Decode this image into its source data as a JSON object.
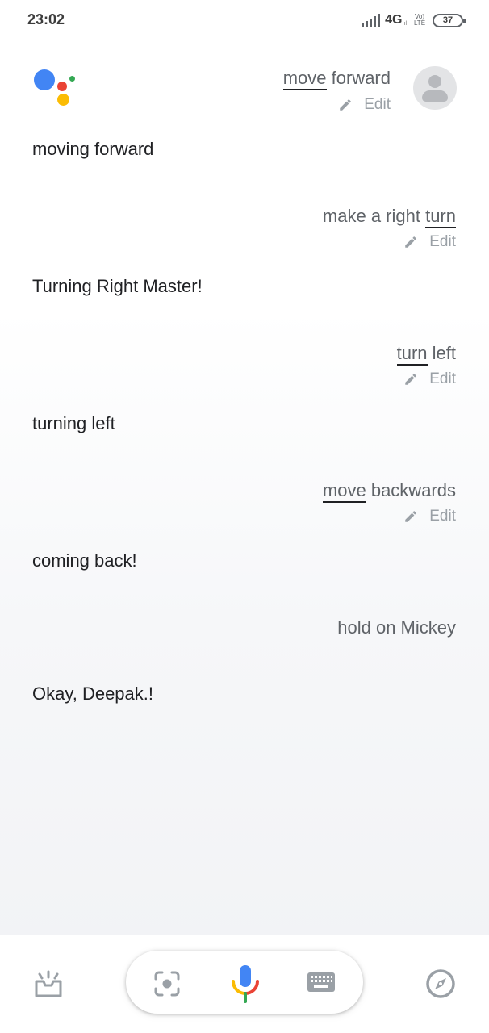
{
  "status_bar": {
    "time": "23:02",
    "network": "4G",
    "network_sub": "ıl",
    "volte": "Vo) LTE",
    "battery": "37"
  },
  "conversation": [
    {
      "type": "user",
      "parts": [
        {
          "text": "move",
          "underline": true
        },
        {
          "text": " forward",
          "underline": false
        }
      ],
      "edit_label": "Edit"
    },
    {
      "type": "assistant",
      "text": "moving forward"
    },
    {
      "type": "user",
      "parts": [
        {
          "text": "make a right ",
          "underline": false
        },
        {
          "text": "turn",
          "underline": true
        }
      ],
      "edit_label": "Edit"
    },
    {
      "type": "assistant",
      "text": "Turning Right Master!"
    },
    {
      "type": "user",
      "parts": [
        {
          "text": "turn",
          "underline": true
        },
        {
          "text": " left",
          "underline": false
        }
      ],
      "edit_label": "Edit"
    },
    {
      "type": "assistant",
      "text": "turning left"
    },
    {
      "type": "user",
      "parts": [
        {
          "text": "move",
          "underline": true
        },
        {
          "text": " backwards",
          "underline": false
        }
      ],
      "edit_label": "Edit"
    },
    {
      "type": "assistant",
      "text": "coming back!"
    },
    {
      "type": "user",
      "parts": [
        {
          "text": "hold on Mickey",
          "underline": false
        }
      ]
    },
    {
      "type": "assistant",
      "text": "Okay, Deepak.!"
    }
  ],
  "bottom_bar": {
    "icons": [
      "updates-tray-icon",
      "lens-icon",
      "microphone-icon",
      "keyboard-icon",
      "explore-compass-icon"
    ]
  },
  "colors": {
    "google_blue": "#4285f4",
    "google_red": "#ea4335",
    "google_yellow": "#fbbc04",
    "google_green": "#34a853",
    "query_text": "#5f6368",
    "edit_text": "#9aa0a6"
  }
}
